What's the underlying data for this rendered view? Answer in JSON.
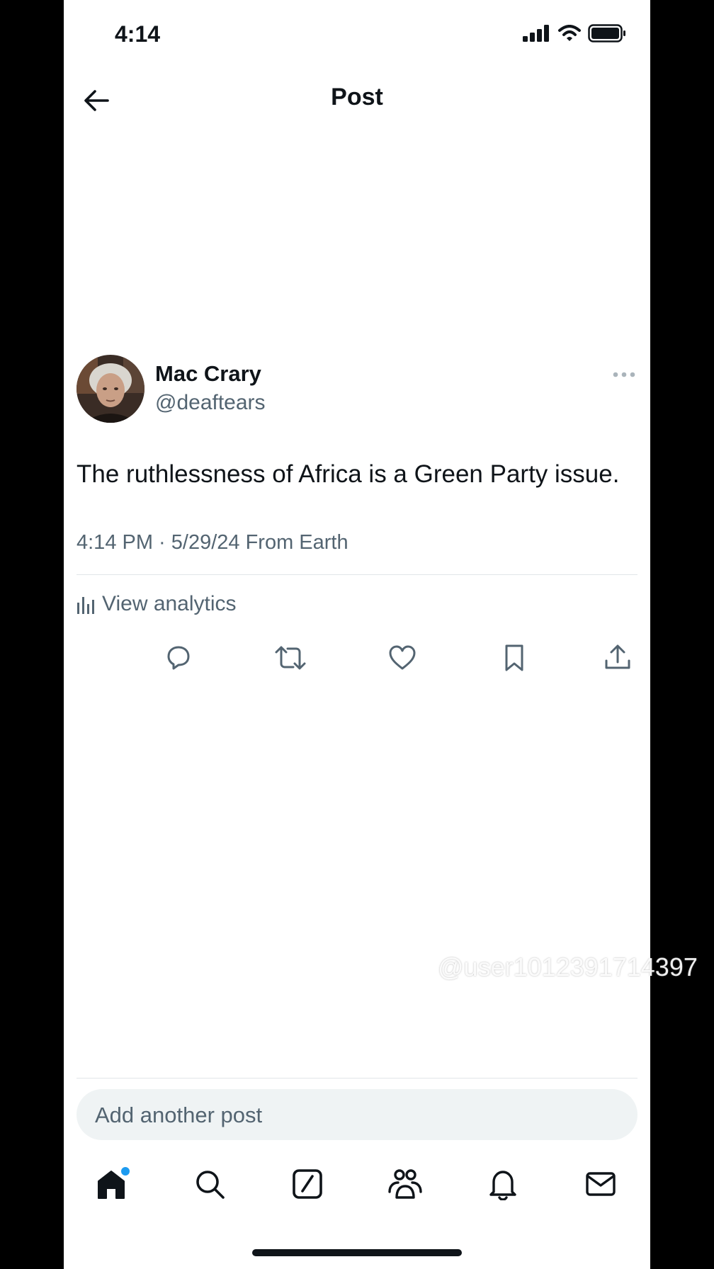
{
  "status": {
    "time": "4:14"
  },
  "header": {
    "title": "Post"
  },
  "post": {
    "author_name": "Mac Crary",
    "author_handle": "@deaftears",
    "text": "The ruthlessness of Africa is a Green Party issue.",
    "meta": "4:14 PM · 5/29/24 From Earth",
    "analytics_label": "View analytics"
  },
  "composer": {
    "placeholder": "Add another post"
  },
  "watermark": {
    "text": "@user1012391714397"
  },
  "icons": {
    "back": "arrow-left-icon",
    "more": "more-icon",
    "actions": [
      "reply-icon",
      "repost-icon",
      "like-icon",
      "bookmark-icon",
      "share-icon"
    ],
    "tabs": [
      "home-icon",
      "search-icon",
      "grok-icon",
      "communities-icon",
      "notifications-icon",
      "messages-icon"
    ]
  },
  "colors": {
    "text": "#0f1419",
    "secondary": "#536471",
    "accent": "#1d9bf0"
  }
}
